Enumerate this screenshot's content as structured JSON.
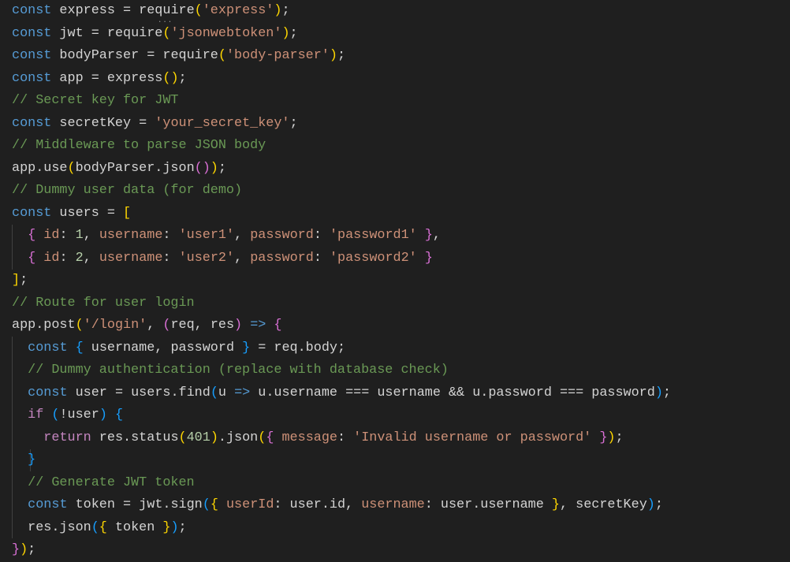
{
  "editor": {
    "language": "javascript",
    "theme_colors": {
      "background": "#1f1f1f",
      "keyword": "#569cd6",
      "control": "#c586c0",
      "identifier": "#d4d4d4",
      "string": "#ce9178",
      "comment": "#6a9955",
      "number": "#b5cea8",
      "bracket_level_1": "#ffd700",
      "bracket_level_2": "#da70d6",
      "bracket_level_3": "#179fff"
    },
    "lines": [
      [
        [
          "kw",
          "const"
        ],
        [
          "id",
          " express "
        ],
        [
          "op",
          "= "
        ],
        [
          "fn",
          "require"
        ],
        [
          "b1",
          "("
        ],
        [
          "str",
          "'express'"
        ],
        [
          "b1",
          ")"
        ],
        [
          "id",
          ";"
        ]
      ],
      [
        [
          "kw",
          "const"
        ],
        [
          "id",
          " jwt "
        ],
        [
          "op",
          "= "
        ],
        [
          "fn",
          "require"
        ],
        [
          "b1",
          "("
        ],
        [
          "str",
          "'jsonwebtoken'"
        ],
        [
          "b1",
          ")"
        ],
        [
          "id",
          ";"
        ]
      ],
      [
        [
          "kw",
          "const"
        ],
        [
          "id",
          " bodyParser "
        ],
        [
          "op",
          "= "
        ],
        [
          "fn",
          "require"
        ],
        [
          "b1",
          "("
        ],
        [
          "str",
          "'body-parser'"
        ],
        [
          "b1",
          ")"
        ],
        [
          "id",
          ";"
        ]
      ],
      [
        [
          "kw",
          "const"
        ],
        [
          "id",
          " app "
        ],
        [
          "op",
          "= "
        ],
        [
          "fn",
          "express"
        ],
        [
          "b1",
          "()"
        ],
        [
          "id",
          ";"
        ]
      ],
      [
        [
          "cm",
          "// Secret key for JWT"
        ]
      ],
      [
        [
          "kw",
          "const"
        ],
        [
          "id",
          " secretKey "
        ],
        [
          "op",
          "= "
        ],
        [
          "str",
          "'your_secret_key'"
        ],
        [
          "id",
          ";"
        ]
      ],
      [
        [
          "cm",
          "// Middleware to parse JSON body"
        ]
      ],
      [
        [
          "id",
          "app.use"
        ],
        [
          "b1",
          "("
        ],
        [
          "id",
          "bodyParser.json"
        ],
        [
          "b2",
          "()"
        ],
        [
          "b1",
          ")"
        ],
        [
          "id",
          ";"
        ]
      ],
      [
        [
          "cm",
          "// Dummy user data (for demo)"
        ]
      ],
      [
        [
          "kw",
          "const"
        ],
        [
          "id",
          " users "
        ],
        [
          "op",
          "= "
        ],
        [
          "b1",
          "["
        ]
      ],
      [
        [
          "id",
          "  "
        ],
        [
          "b2",
          "{"
        ],
        [
          "prop",
          " id"
        ],
        [
          "id",
          ": "
        ],
        [
          "num",
          "1"
        ],
        [
          "id",
          ", "
        ],
        [
          "prop",
          "username"
        ],
        [
          "id",
          ": "
        ],
        [
          "str",
          "'user1'"
        ],
        [
          "id",
          ", "
        ],
        [
          "prop",
          "password"
        ],
        [
          "id",
          ": "
        ],
        [
          "str",
          "'password1'"
        ],
        [
          "id",
          " "
        ],
        [
          "b2",
          "}"
        ],
        [
          "id",
          ","
        ]
      ],
      [
        [
          "id",
          "  "
        ],
        [
          "b2",
          "{"
        ],
        [
          "prop",
          " id"
        ],
        [
          "id",
          ": "
        ],
        [
          "num",
          "2"
        ],
        [
          "id",
          ", "
        ],
        [
          "prop",
          "username"
        ],
        [
          "id",
          ": "
        ],
        [
          "str",
          "'user2'"
        ],
        [
          "id",
          ", "
        ],
        [
          "prop",
          "password"
        ],
        [
          "id",
          ": "
        ],
        [
          "str",
          "'password2'"
        ],
        [
          "id",
          " "
        ],
        [
          "b2",
          "}"
        ]
      ],
      [
        [
          "b1",
          "]"
        ],
        [
          "id",
          ";"
        ]
      ],
      [
        [
          "cm",
          "// Route for user login"
        ]
      ],
      [
        [
          "id",
          "app.post"
        ],
        [
          "b1",
          "("
        ],
        [
          "str",
          "'/login'"
        ],
        [
          "id",
          ", "
        ],
        [
          "b2",
          "("
        ],
        [
          "id",
          "req, res"
        ],
        [
          "b2",
          ")"
        ],
        [
          "arrow",
          " =>"
        ],
        [
          "id",
          " "
        ],
        [
          "b2",
          "{"
        ]
      ],
      [
        [
          "id",
          "  "
        ],
        [
          "kw",
          "const"
        ],
        [
          "id",
          " "
        ],
        [
          "b3",
          "{"
        ],
        [
          "id",
          " username, password "
        ],
        [
          "b3",
          "}"
        ],
        [
          "op",
          " = "
        ],
        [
          "id",
          "req.body;"
        ]
      ],
      [
        [
          "cm",
          "  // Dummy authentication (replace with database check)"
        ]
      ],
      [
        [
          "id",
          "  "
        ],
        [
          "kw",
          "const"
        ],
        [
          "id",
          " user "
        ],
        [
          "op",
          "= "
        ],
        [
          "id",
          "users.find"
        ],
        [
          "b3",
          "("
        ],
        [
          "id",
          "u "
        ],
        [
          "arrow",
          "=>"
        ],
        [
          "id",
          " u.username === username && u.password === password"
        ],
        [
          "b3",
          ")"
        ],
        [
          "id",
          ";"
        ]
      ],
      [
        [
          "id",
          "  "
        ],
        [
          "ctl",
          "if"
        ],
        [
          "id",
          " "
        ],
        [
          "b3",
          "("
        ],
        [
          "id",
          "!user"
        ],
        [
          "b3",
          ")"
        ],
        [
          "id",
          " "
        ],
        [
          "b3",
          "{"
        ]
      ],
      [
        [
          "id",
          "    "
        ],
        [
          "ctl",
          "return"
        ],
        [
          "id",
          " res.status"
        ],
        [
          "b1",
          "("
        ],
        [
          "num",
          "401"
        ],
        [
          "b1",
          ")"
        ],
        [
          "id",
          ".json"
        ],
        [
          "b1",
          "("
        ],
        [
          "b2",
          "{"
        ],
        [
          "prop",
          " message"
        ],
        [
          "id",
          ": "
        ],
        [
          "str",
          "'Invalid username or password'"
        ],
        [
          "id",
          " "
        ],
        [
          "b2",
          "}"
        ],
        [
          "b1",
          ")"
        ],
        [
          "id",
          ";"
        ]
      ],
      [
        [
          "id",
          "  "
        ],
        [
          "b3",
          "}"
        ]
      ],
      [
        [
          "cm",
          "  // Generate JWT token"
        ]
      ],
      [
        [
          "id",
          "  "
        ],
        [
          "kw",
          "const"
        ],
        [
          "id",
          " token "
        ],
        [
          "op",
          "= "
        ],
        [
          "id",
          "jwt.sign"
        ],
        [
          "b3",
          "("
        ],
        [
          "b1",
          "{"
        ],
        [
          "prop",
          " userId"
        ],
        [
          "id",
          ": user.id, "
        ],
        [
          "prop",
          "username"
        ],
        [
          "id",
          ": user.username "
        ],
        [
          "b1",
          "}"
        ],
        [
          "id",
          ", secretKey"
        ],
        [
          "b3",
          ")"
        ],
        [
          "id",
          ";"
        ]
      ],
      [
        [
          "id",
          "  res.json"
        ],
        [
          "b3",
          "("
        ],
        [
          "b1",
          "{"
        ],
        [
          "id",
          " token "
        ],
        [
          "b1",
          "}"
        ],
        [
          "b3",
          ")"
        ],
        [
          "id",
          ";"
        ]
      ],
      [
        [
          "b2",
          "}"
        ],
        [
          "b1",
          ")"
        ],
        [
          "id",
          ";"
        ]
      ]
    ],
    "hint_marker": "..."
  }
}
